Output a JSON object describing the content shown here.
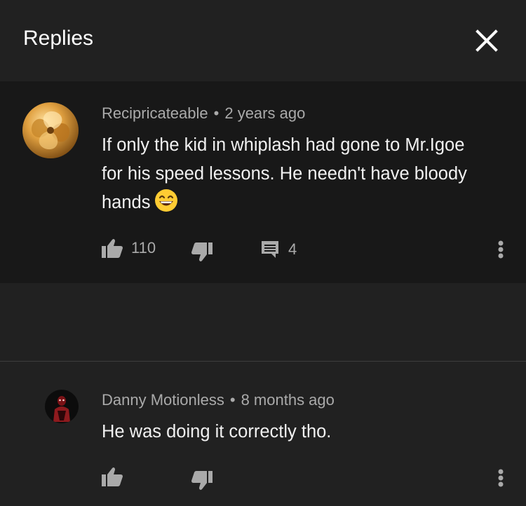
{
  "header": {
    "title": "Replies",
    "close_icon": "close-icon"
  },
  "parent_comment": {
    "author": "Recipricateable",
    "separator": "•",
    "time": "2 years ago",
    "text_lines": [
      "If only the kid in whiplash had gone to Mr.Igoe",
      "for his speed lessons. He needn't have bloody",
      "hands"
    ],
    "emoji": "grinning-face-with-smiling-eyes-icon",
    "like_count": "110",
    "reply_count": "4"
  },
  "reply": {
    "author": "Danny Motionless",
    "separator": "•",
    "time": "8 months ago",
    "text": "He was doing it correctly tho."
  },
  "colors": {
    "background": "#212121",
    "comment_background": "#181818",
    "text_primary": "#f1f1f1",
    "text_secondary": "#aaaaaa",
    "divider": "#3d3d3d"
  }
}
